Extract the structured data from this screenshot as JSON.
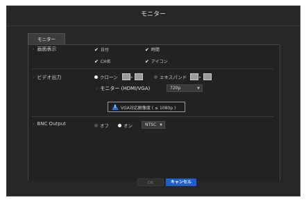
{
  "window": {
    "title": "モニター"
  },
  "tabs": [
    {
      "label": "モニター"
    }
  ],
  "display": {
    "label": "画面表示",
    "options": [
      {
        "label": "日付",
        "checked": true
      },
      {
        "label": "時間",
        "checked": true
      },
      {
        "label": "CH名",
        "checked": true
      },
      {
        "label": "アイコン",
        "checked": true
      }
    ]
  },
  "video_output": {
    "label": "ビデオ出力",
    "mode_clone": "クローン",
    "mode_expand": "エキスパンド",
    "selected_mode": "クローン",
    "monitor_label": "モニター (HDMI/VGA)",
    "resolution": "720p",
    "notice": "VGA対応解像度 ( ≤ 1080p )"
  },
  "bnc_output": {
    "label": "BNC Output",
    "off_label": "オフ",
    "on_label": "オン",
    "selected": "オン",
    "standard": "NTSC"
  },
  "buttons": {
    "ok": "OK",
    "cancel": "キャンセル"
  },
  "colors": {
    "accent": "#1d5fd0",
    "background": "#262626"
  }
}
